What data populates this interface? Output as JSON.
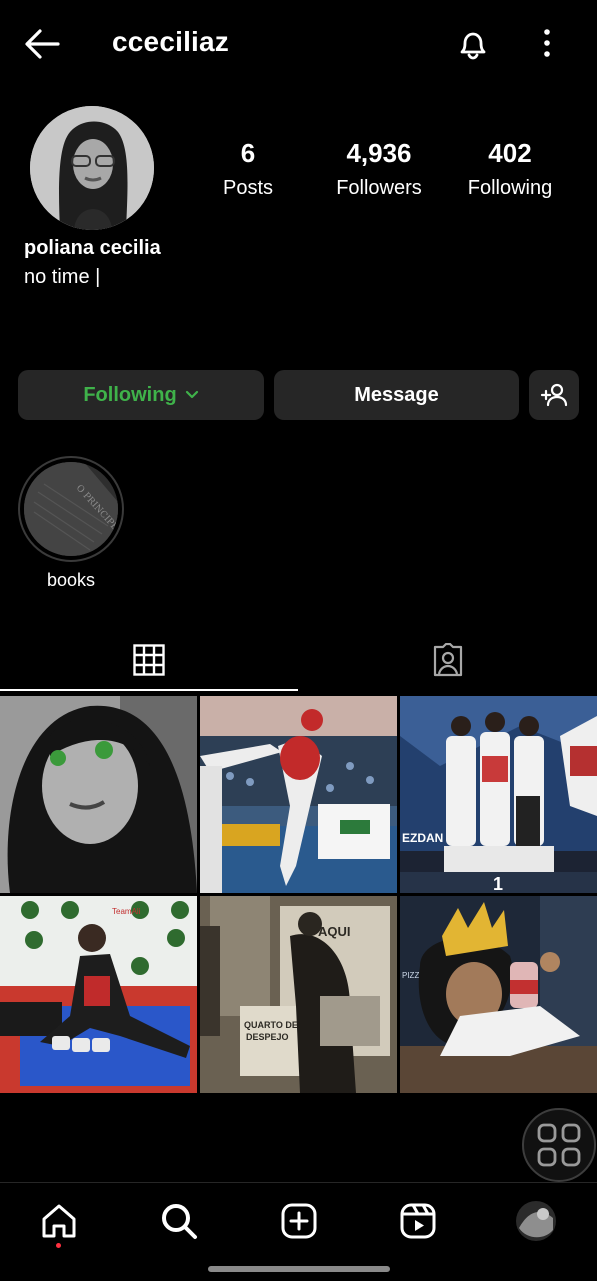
{
  "header": {
    "username": "cceciliaz",
    "back_icon": "arrow-left-icon",
    "bell_icon": "bell-icon",
    "more_icon": "more-vertical-icon"
  },
  "profile": {
    "stats": [
      {
        "value": "6",
        "label": "Posts"
      },
      {
        "value": "4,936",
        "label": "Followers"
      },
      {
        "value": "402",
        "label": "Following"
      }
    ],
    "name": "poliana cecilia",
    "bio": "no time |"
  },
  "actions": {
    "following_label": "Following",
    "message_label": "Message",
    "following_color": "#3fb24a"
  },
  "highlights": [
    {
      "label": "books",
      "book_text": "O PRINCIPE"
    }
  ],
  "tabs": {
    "active": "grid",
    "grid_icon": "grid-icon",
    "tagged_icon": "tagged-person-icon"
  },
  "posts": {
    "post2_banner": "",
    "post3_text": "EZDAN",
    "post3_podium": "1",
    "post4_text": "TeamAli",
    "post5_lines": [
      "AQUI",
      "QUARTO DE",
      "DESPEJO"
    ],
    "post6_text": "PIZZA MANOR"
  },
  "nav": {
    "items": [
      "home-icon",
      "search-icon",
      "create-icon",
      "reels-icon",
      "profile-avatar"
    ]
  }
}
